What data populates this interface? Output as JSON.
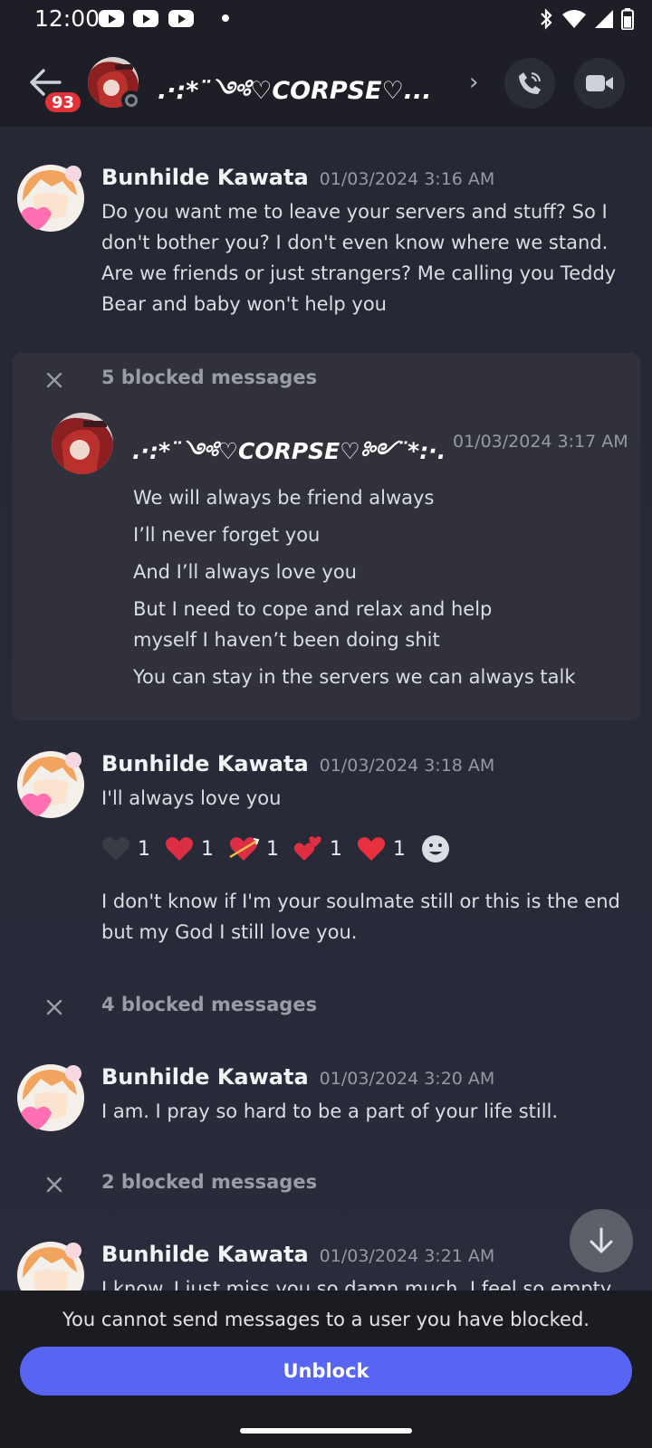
{
  "status_bar": {
    "time": "12:00"
  },
  "header": {
    "unread_badge": "93",
    "title": ".·:*¨༺♡CORPSE♡...",
    "chevron": "›"
  },
  "messages": [
    {
      "author": "Bunhilde Kawata",
      "timestamp": "01/03/2024 3:16 AM",
      "text": "Do you want me to leave your servers and stuff? So I don't bother you? I don't even know where we stand. Are we friends or just strangers? Me calling you Teddy Bear and baby won't help you"
    },
    {
      "author": "Bunhilde Kawata",
      "timestamp": "01/03/2024 3:18 AM",
      "text": "I'll always love you",
      "text2": "I don't know if I'm your soulmate still or this is the end but my God I still love you."
    },
    {
      "author": "Bunhilde Kawata",
      "timestamp": "01/03/2024 3:20 AM",
      "text": "I am. I pray so hard to be a part of your life still."
    },
    {
      "author": "Bunhilde Kawata",
      "timestamp": "01/03/2024 3:21 AM",
      "text": "I know. I just miss you so damn much. I feel so empty"
    }
  ],
  "blocked_groups": [
    {
      "label": "5 blocked messages"
    },
    {
      "label": "4 blocked messages"
    },
    {
      "label": "2 blocked messages"
    }
  ],
  "revealed_blocked": {
    "author": ".·:*¨༺♡CORPSE♡༻¨*:·.",
    "timestamp": "01/03/2024 3:17 AM",
    "lines": [
      "We will always be friend always",
      "I’ll never forget you",
      "And I’ll always love you",
      "But I need to cope and relax and help myself I haven’t been doing shit",
      "You can stay in the servers we can always talk"
    ]
  },
  "reactions": [
    {
      "icon": "black-heart-icon",
      "color": "#2b2d33",
      "count": "1"
    },
    {
      "icon": "red-heart-icon",
      "color": "#dd2e44",
      "count": "1"
    },
    {
      "icon": "heart-with-arrow-icon",
      "color": "#dd2e44",
      "count": "1"
    },
    {
      "icon": "two-hearts-icon",
      "color": "#dd2e44",
      "count": "1"
    },
    {
      "icon": "red-heart-icon",
      "color": "#e8303e",
      "count": "1"
    }
  ],
  "footer": {
    "note": "You cannot send messages to a user you have blocked.",
    "unblock_label": "Unblock"
  },
  "colors": {
    "accent": "#5865f2",
    "badge": "#e0323a"
  }
}
